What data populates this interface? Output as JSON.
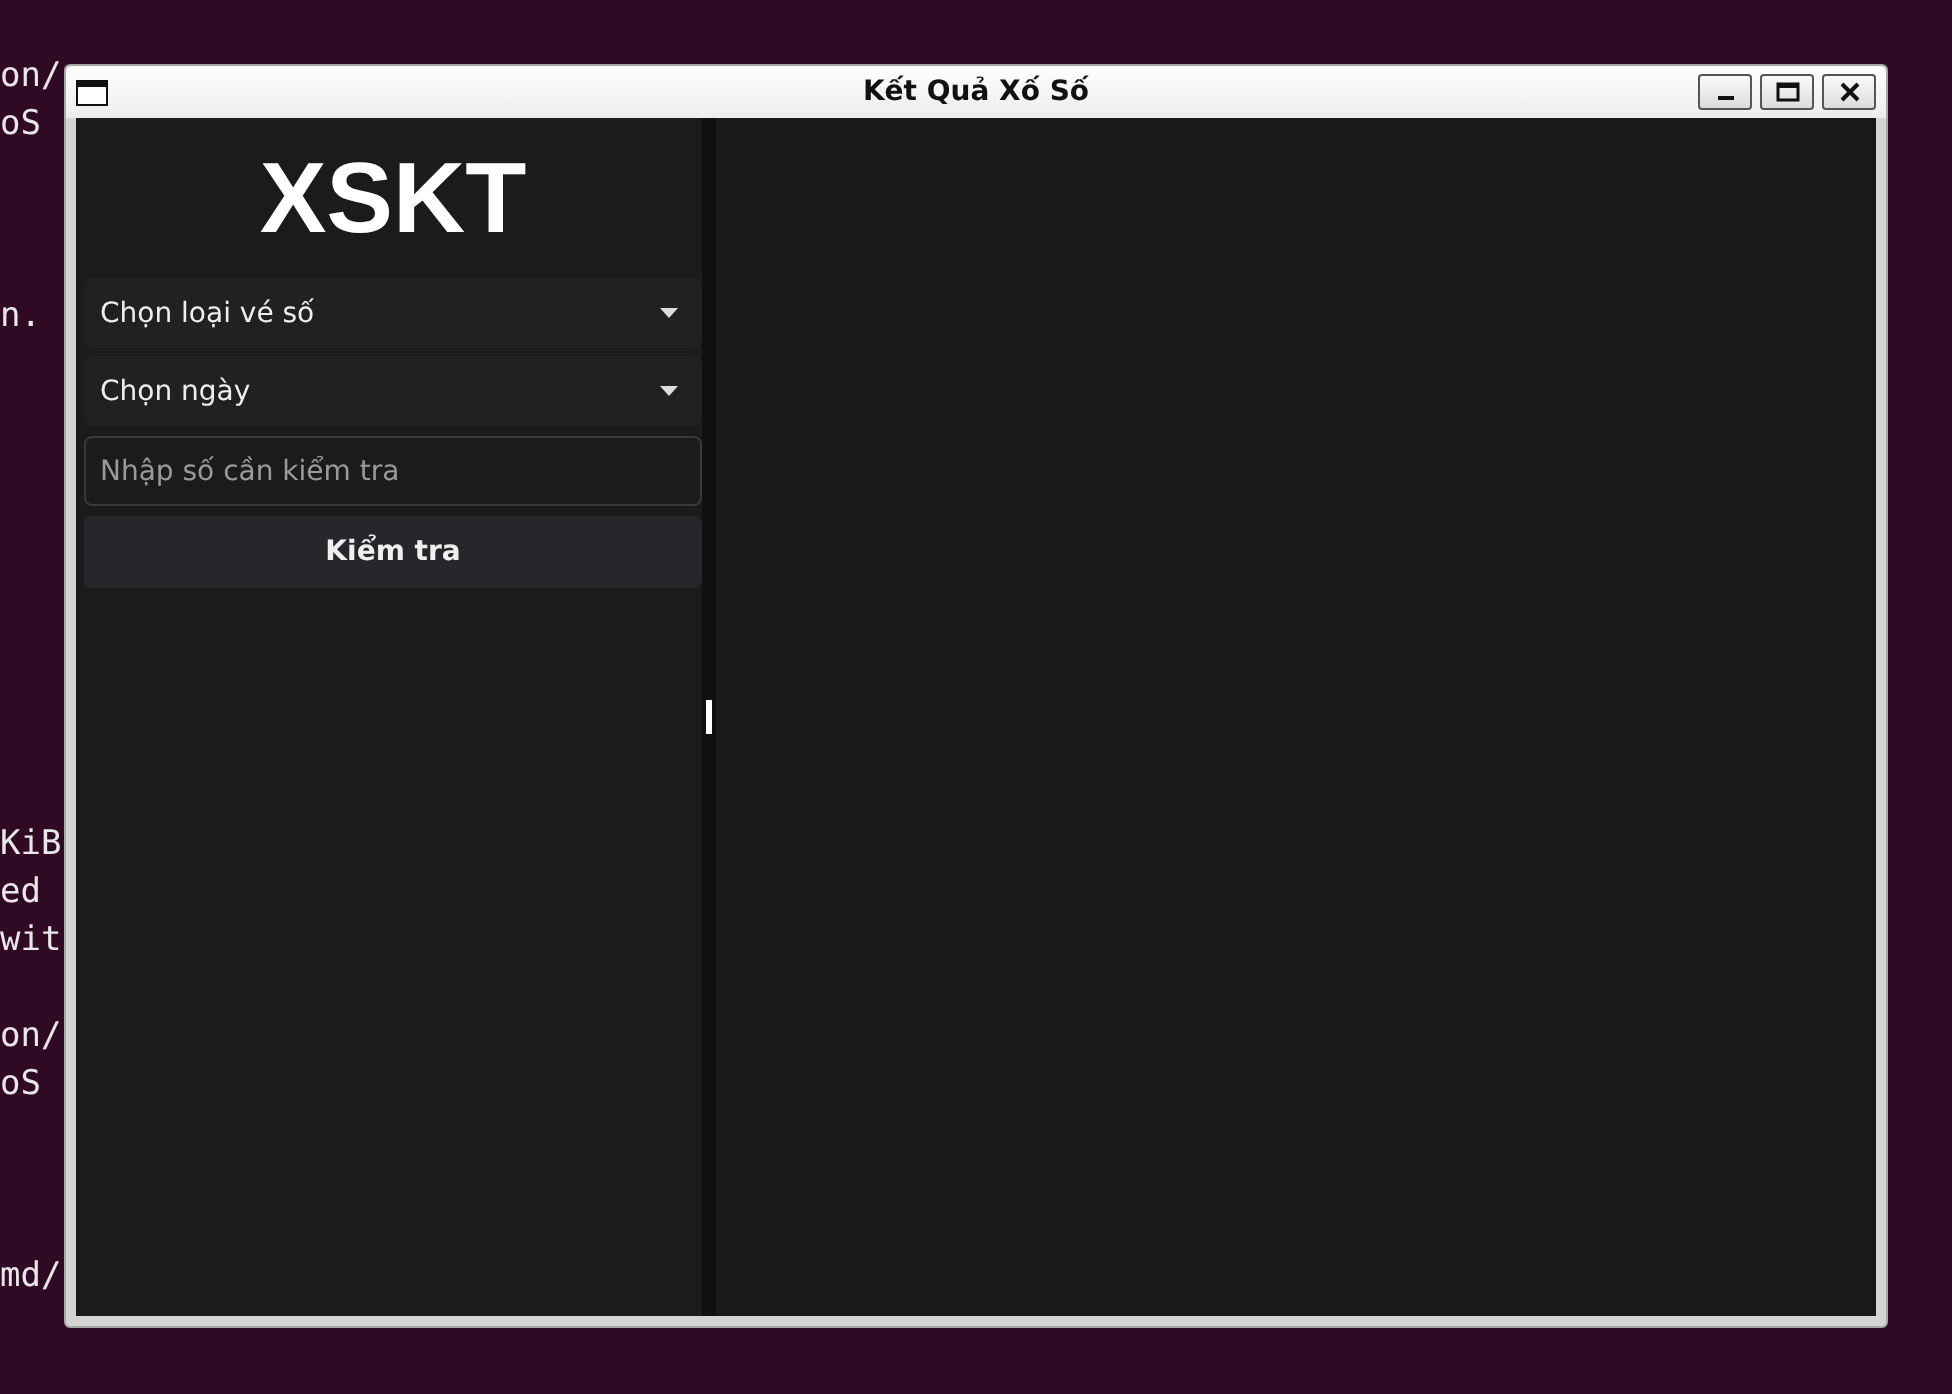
{
  "terminal": {
    "lines": [
      "on/",
      "oS",
      "n.",
      "KiB",
      "ed",
      "wit",
      "on/",
      "oS",
      "md/"
    ]
  },
  "window": {
    "title": "Kết Quả Xố Số"
  },
  "sidebar": {
    "logo": "XSKT",
    "dropdowns": [
      {
        "label": "Chọn loại vé số"
      },
      {
        "label": "Chọn ngày"
      }
    ],
    "number_field": {
      "placeholder": "Nhập số cần kiểm tra"
    },
    "check_button": "Kiểm tra"
  }
}
